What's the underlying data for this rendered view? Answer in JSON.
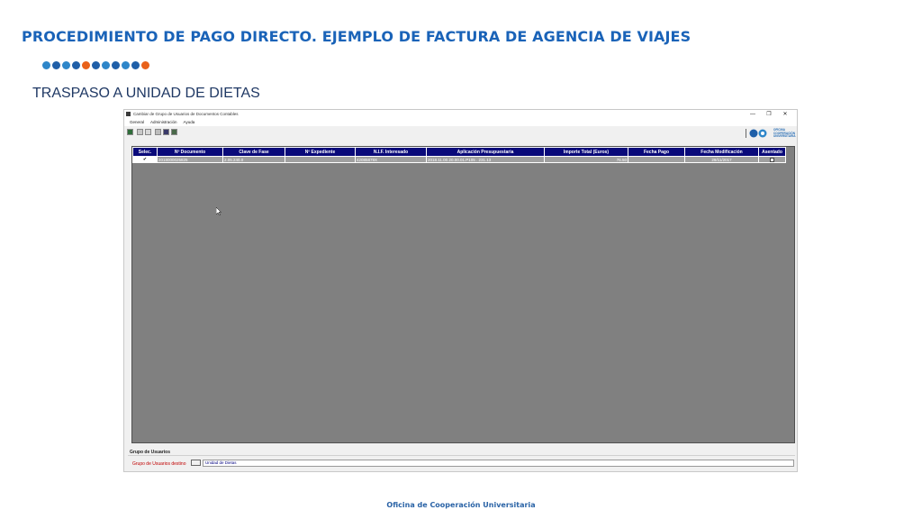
{
  "slide": {
    "title": "PROCEDIMIENTO DE PAGO DIRECTO. EJEMPLO DE FACTURA DE AGENCIA DE VIAJES",
    "subtitle": "TRASPASO A UNIDAD DE DIETAS",
    "footer": "Oficina de Cooperación Universitaria",
    "dot_colors": [
      "#2e86c9",
      "#1f5fa8",
      "#2e86c9",
      "#1f5fa8",
      "#e8611a",
      "#1f5fa8",
      "#2e86c9",
      "#1f5fa8",
      "#2e86c9",
      "#1f5fa8",
      "#e8611a"
    ]
  },
  "window": {
    "title": "Cambiar de Grupo de Usuarios de Documentos Contables",
    "controls": {
      "minimize": "—",
      "restore": "❐",
      "close": "✕"
    },
    "menu": [
      "General",
      "Administración",
      "Ayuda"
    ],
    "brand": {
      "line1": "OFICINA",
      "line2": "COOPERACIÓN",
      "line3": "UNIVERSITARIA"
    }
  },
  "table": {
    "headers": [
      "Selec.",
      "Nº Documento",
      "Clave de Fase",
      "Nº Expediente",
      "N.I.F. Interesado",
      "Aplicación Presupuestaria",
      "Importe Total (Euros)",
      "Fecha Pago",
      "Fecha Modificación",
      "Asentado"
    ],
    "rows": [
      {
        "selected": "✔",
        "documento": "2018000025825",
        "clave_fase": "2.05.240.0",
        "expediente": "",
        "nif": "42085879X",
        "aplicacion": "2018.11.00.20.00.01.P105 . 231.13",
        "importe": "76.50",
        "fecha_pago": "",
        "fecha_modificacion": "29/11/2017",
        "asentado": ""
      }
    ]
  },
  "group": {
    "section_label": "Grupo de Usuarios",
    "dest_label": "Grupo de Usuarios destino",
    "dest_value": "Unidad de Dietas"
  }
}
